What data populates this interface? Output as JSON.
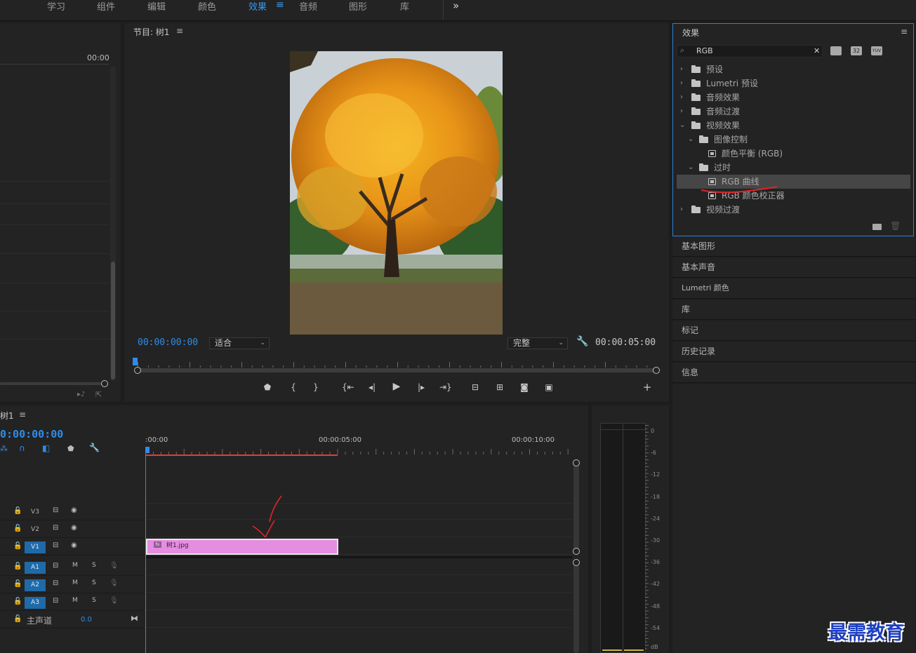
{
  "workspaces": {
    "items": [
      "学习",
      "组件",
      "编辑",
      "颜色",
      "效果",
      "音频",
      "图形",
      "库"
    ],
    "active": "效果",
    "active_menu_glyph": "≡",
    "overflow_glyph": "»"
  },
  "source_panel": {
    "timecode": "00:00"
  },
  "program_monitor": {
    "title": "节目: 树1",
    "menu_glyph": "≡",
    "current_time": "00:00:00:00",
    "fit_select": "适合",
    "quality_select": "完整",
    "duration": "00:00:05:00",
    "wrench_icon": "wrench-icon",
    "add_glyph": "+",
    "controls": [
      "add-marker",
      "mark-in",
      "mark-out",
      "go-to-in",
      "step-back",
      "play",
      "step-forward",
      "go-to-out",
      "lift",
      "extract",
      "export-frame",
      "compare"
    ]
  },
  "effects_panel": {
    "title": "效果",
    "menu_glyph": "≡",
    "search_value": "RGB",
    "clear_glyph": "✕",
    "filter_buttons": [
      "32",
      "YUV"
    ],
    "tree": [
      {
        "label": "预设",
        "type": "folder-star",
        "depth": 0,
        "expanded": false
      },
      {
        "label": "Lumetri 预设",
        "type": "folder-star",
        "depth": 0,
        "expanded": false
      },
      {
        "label": "音频效果",
        "type": "folder",
        "depth": 0,
        "expanded": false
      },
      {
        "label": "音频过渡",
        "type": "folder",
        "depth": 0,
        "expanded": false
      },
      {
        "label": "视频效果",
        "type": "folder",
        "depth": 0,
        "expanded": true
      },
      {
        "label": "图像控制",
        "type": "folder",
        "depth": 1,
        "expanded": true
      },
      {
        "label": "颜色平衡 (RGB)",
        "type": "effect",
        "depth": 2
      },
      {
        "label": "过时",
        "type": "folder",
        "depth": 1,
        "expanded": true
      },
      {
        "label": "RGB 曲线",
        "type": "effect",
        "depth": 2,
        "selected": true
      },
      {
        "label": "RGB 颜色校正器",
        "type": "effect",
        "depth": 2
      },
      {
        "label": "视频过渡",
        "type": "folder",
        "depth": 0,
        "expanded": false
      }
    ]
  },
  "side_panels": [
    "基本图形",
    "基本声音",
    "Lumetri 颜色",
    "库",
    "标记",
    "历史记录",
    "信息"
  ],
  "timeline": {
    "title": "树1",
    "menu_glyph": "≡",
    "timecode": "0:00:00:00",
    "ruler": [
      ":00:00",
      "00:00:05:00",
      "00:00:10:00"
    ],
    "video_tracks": [
      {
        "name": "V3",
        "target": false
      },
      {
        "name": "V2",
        "target": false
      },
      {
        "name": "V1",
        "target": true
      }
    ],
    "audio_tracks": [
      {
        "name": "A1",
        "target": true
      },
      {
        "name": "A2",
        "target": true
      },
      {
        "name": "A3",
        "target": true
      }
    ],
    "mute_label": "M",
    "solo_label": "S",
    "master_label": "主声道",
    "master_value": "0.0",
    "clip": {
      "name": "树1.jpg",
      "badge": "fx",
      "color": "#e58de0",
      "duration_seconds": 5
    }
  },
  "audio_meter": {
    "scale": [
      "0",
      "-6",
      "-12",
      "-18",
      "-24",
      "-30",
      "-36",
      "-42",
      "-48",
      "-54",
      "dB"
    ]
  },
  "watermark": "最需教育",
  "colors": {
    "accent": "#2d8ceb",
    "playhead": "#e23b3b",
    "clip": "#e58de0",
    "target": "#1f6aa8"
  }
}
